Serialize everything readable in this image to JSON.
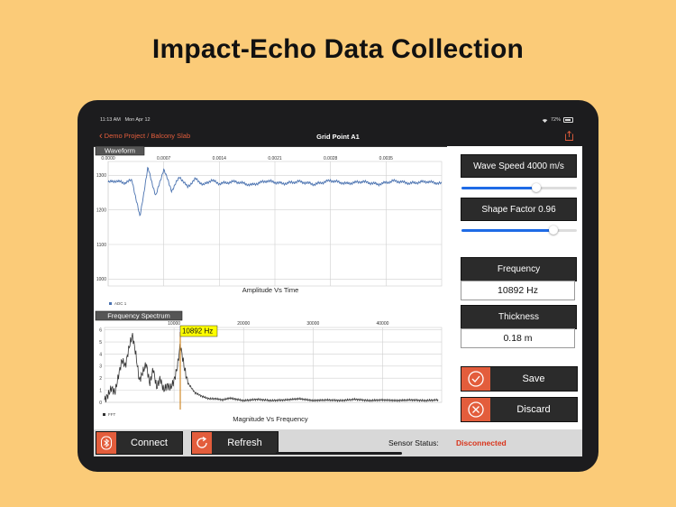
{
  "headline": "Impact-Echo Data Collection",
  "status_bar": {
    "time": "11:13 AM",
    "date": "Mon Apr 12",
    "battery": "72%"
  },
  "nav": {
    "back_label": "Demo Project / Balcony Slab",
    "title": "Grid Point A1",
    "share_icon": "share-icon"
  },
  "colors": {
    "accent": "#E35D3C",
    "slider_blue": "#1E6BE6",
    "status_red": "#D9341B",
    "waveform_line": "#4A72B0",
    "marker_line": "#D08A2A",
    "annotation_bg": "#FFFF00"
  },
  "chart_data": [
    {
      "type": "line",
      "title": "Amplitude Vs Time",
      "tab_label": "Waveform",
      "legend": "ADC 1",
      "x_ticks": [
        "0.0000",
        "0.0007",
        "0.0014",
        "0.0021",
        "0.0028",
        "0.0035"
      ],
      "y_ticks": [
        "1300",
        "1200",
        "1100",
        "1000"
      ],
      "xlim": [
        0,
        0.0042
      ],
      "ylim": [
        980,
        1340
      ],
      "grid": true,
      "series": [
        {
          "x": [
            0,
            0.0001,
            0.0002,
            0.0003,
            0.0004,
            0.0005,
            0.0006,
            0.0007,
            0.0008,
            0.0009,
            0.001,
            0.0011,
            0.0012,
            0.0013,
            0.0014,
            0.0016,
            0.0018,
            0.002,
            0.0022,
            0.0024,
            0.0026,
            0.0028,
            0.003,
            0.0032,
            0.0034,
            0.0036,
            0.0038,
            0.004,
            0.0042
          ],
          "y": [
            1280,
            1284,
            1278,
            1286,
            1180,
            1322,
            1240,
            1318,
            1255,
            1296,
            1266,
            1290,
            1272,
            1286,
            1276,
            1282,
            1272,
            1284,
            1276,
            1282,
            1274,
            1285,
            1276,
            1282,
            1274,
            1284,
            1277,
            1282,
            1276
          ]
        }
      ]
    },
    {
      "type": "line",
      "title": "Magnitude Vs Frequency",
      "tab_label": "Frequency Spectrum",
      "legend": "FFT",
      "annotation": "10892 Hz",
      "marker_x": 10892,
      "x_ticks": [
        "10000",
        "20000",
        "30000",
        "40000"
      ],
      "x_tick_values": [
        10000,
        20000,
        30000,
        40000
      ],
      "y_ticks": [
        "6",
        "5",
        "4",
        "3",
        "2",
        "1",
        "0"
      ],
      "y_tick_values": [
        6,
        5,
        4,
        3,
        2,
        1,
        0
      ],
      "xlim": [
        0,
        48500
      ],
      "ylim": [
        0,
        6.2
      ],
      "grid": true,
      "series": [
        {
          "x": [
            0,
            500,
            1000,
            1500,
            2000,
            2500,
            3000,
            3500,
            4000,
            4500,
            5000,
            5500,
            6000,
            6500,
            7000,
            7500,
            8000,
            8500,
            9000,
            9500,
            10000,
            10500,
            10892,
            11500,
            12000,
            12500,
            13000,
            14000,
            15000,
            16000,
            17000,
            18000,
            20000,
            22000,
            24000,
            26000,
            28000,
            30000,
            32000,
            34000,
            36000,
            38000,
            40000,
            42000,
            44000,
            46000,
            48000
          ],
          "y": [
            0.2,
            0.6,
            1.2,
            0.8,
            2.2,
            3.5,
            3.0,
            4.5,
            5.6,
            4.0,
            1.8,
            2.5,
            3.2,
            1.5,
            2.8,
            1.2,
            2.0,
            1.0,
            1.4,
            1.2,
            1.8,
            3.0,
            4.8,
            2.8,
            1.6,
            1.2,
            0.8,
            0.5,
            0.3,
            0.3,
            0.2,
            0.35,
            0.15,
            0.25,
            0.15,
            0.2,
            0.3,
            0.15,
            0.2,
            0.15,
            0.25,
            0.15,
            0.2,
            0.15,
            0.2,
            0.15,
            0.2
          ]
        }
      ]
    }
  ],
  "panel": {
    "wave_speed_label": "Wave Speed 4000 m/s",
    "wave_speed_fraction": 0.65,
    "shape_factor_label": "Shape Factor 0.96",
    "shape_factor_fraction": 0.8,
    "frequency_label": "Frequency",
    "frequency_value": "10892 Hz",
    "thickness_label": "Thickness",
    "thickness_value": "0.18 m",
    "save_label": "Save",
    "discard_label": "Discard"
  },
  "bottom": {
    "connect_label": "Connect",
    "refresh_label": "Refresh",
    "sensor_status_label": "Sensor Status:",
    "sensor_status_value": "Disconnected"
  }
}
